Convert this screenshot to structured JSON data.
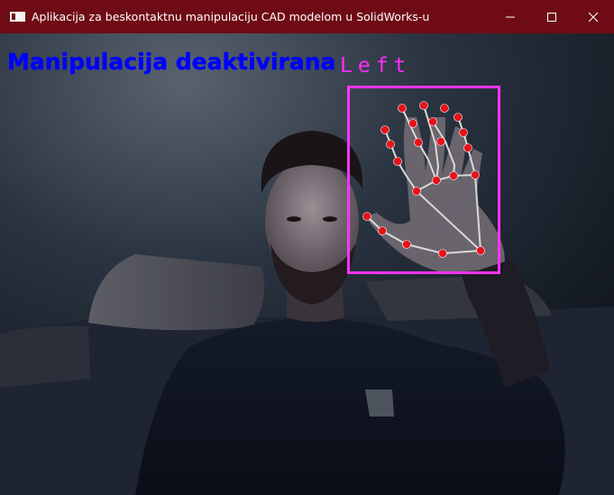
{
  "window": {
    "title": "Aplikacija za beskontaktnu manipulaciju CAD modelom u SolidWorks-u",
    "app_icon": "app-window-icon",
    "controls": [
      "minimize-icon",
      "maximize-icon",
      "close-icon"
    ]
  },
  "overlay": {
    "status_text": "Manipulacija deaktivirana",
    "status_color": "#0000ff",
    "hand_label": "Left",
    "box_color": "#ff33ff",
    "landmark_color": "#e8121a",
    "connection_color": "#d9d9d9"
  },
  "colors": {
    "titlebar": "#6f0b14",
    "background": "#1b2430"
  }
}
